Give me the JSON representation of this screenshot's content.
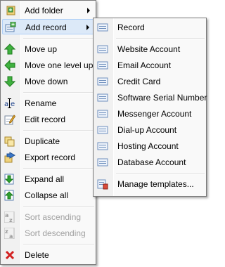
{
  "main_menu": {
    "add_folder": "Add folder",
    "add_record": "Add record",
    "move_up": "Move up",
    "move_one_level_up": "Move one level up",
    "move_down": "Move down",
    "rename": "Rename",
    "edit_record": "Edit record",
    "duplicate": "Duplicate",
    "export_record": "Export record",
    "expand_all": "Expand all",
    "collapse_all": "Collapse all",
    "sort_ascending": "Sort ascending",
    "sort_descending": "Sort descending",
    "delete": "Delete"
  },
  "submenu": {
    "items": [
      "Record",
      "Website Account",
      "Email Account",
      "Credit Card",
      "Software Serial Number",
      "Messenger Account",
      "Dial-up Account",
      "Hosting Account",
      "Database Account"
    ],
    "manage_templates": "Manage templates..."
  },
  "icons": {
    "add_folder": "folder-plus-icon",
    "add_record": "record-plus-icon",
    "move_up": "green-arrow-up-icon",
    "move_one_level_up": "green-arrow-left-icon",
    "move_down": "green-arrow-down-icon",
    "rename": "rename-text-icon",
    "edit_record": "edit-pencil-icon",
    "duplicate": "duplicate-icon",
    "export_record": "export-icon",
    "expand_all": "expand-all-icon",
    "collapse_all": "collapse-all-icon",
    "sort_ascending": "sort-az-icon",
    "sort_descending": "sort-za-icon",
    "delete": "red-x-icon",
    "template": "template-card-icon",
    "manage_templates": "manage-templates-icon"
  },
  "colors": {
    "highlight_bg": "#dce9f8",
    "highlight_border": "#aecff7",
    "disabled_text": "#a0a0a0",
    "arrow_green": "#2fa12f",
    "delete_red": "#d22020"
  }
}
